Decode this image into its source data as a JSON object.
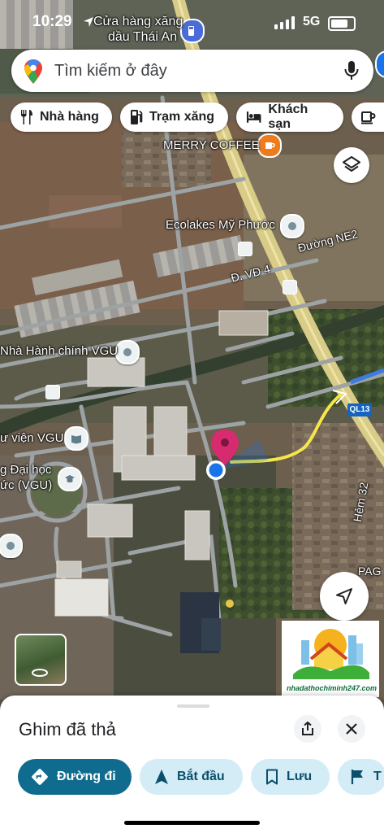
{
  "status_bar": {
    "time": "10:29",
    "network": "5G",
    "battery_level": 0.85
  },
  "search": {
    "placeholder": "Tìm kiếm ở đây"
  },
  "chips": [
    {
      "label": "Nhà hàng",
      "icon": "fork-knife-icon"
    },
    {
      "label": "Trạm xăng",
      "icon": "gas-station-icon"
    },
    {
      "label": "Khách sạn",
      "icon": "bed-icon"
    },
    {
      "label": "",
      "icon": "coffee-icon"
    }
  ],
  "map": {
    "labels": {
      "gas_station_line1": "Cửa hàng xăng",
      "gas_station_line2": "dầu Thái An",
      "merry_coffee": "MERRY COFFEE",
      "ecolakes": "Ecolakes Mỹ Phước",
      "street_ne2": "Đường NE2",
      "street_vd4": "Đ. VĐ 4",
      "vgu_admin": "Nhà Hành chính VGU",
      "vgu_library": "ư viện VGU",
      "vgu_univ_line1": "g Đại học",
      "vgu_univ_line2": "ức (VGU)",
      "hem": "Hẻm 32",
      "edge_label": "PAG",
      "road_badge": "QL13"
    },
    "colors": {
      "route": "#f5e74a",
      "pin": "#d62b6e",
      "my_location": "#1a73e8",
      "main_road": "#e9d98a"
    }
  },
  "watermark": {
    "text": "nhadathochiminh247.com"
  },
  "sheet": {
    "title": "Ghim đã thả",
    "actions": [
      {
        "label": "Đường đi",
        "icon": "directions-icon"
      },
      {
        "label": "Bắt đầu",
        "icon": "navigation-arrow-icon"
      },
      {
        "label": "Lưu",
        "icon": "bookmark-icon"
      },
      {
        "label": "T",
        "icon": "flag-icon"
      }
    ]
  }
}
